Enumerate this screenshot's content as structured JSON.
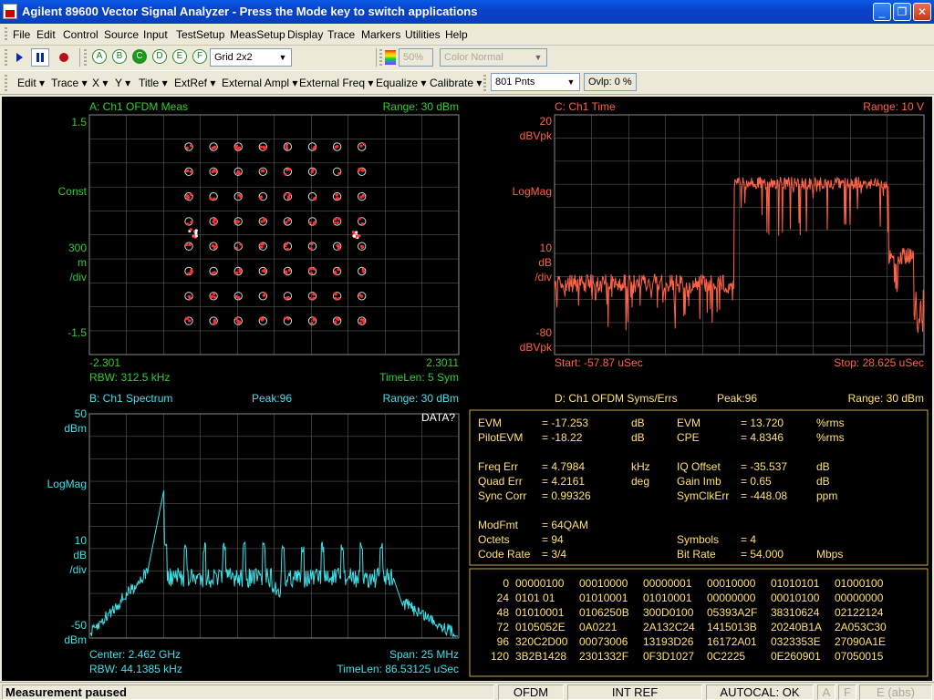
{
  "window": {
    "title": "Agilent 89600 Vector Signal Analyzer - Press the Mode key to switch applications",
    "icon_label": "VSA"
  },
  "menu": [
    "File",
    "Edit",
    "Control",
    "Source",
    "Input",
    "TestSetup",
    "MeasSetup",
    "Display",
    "Trace",
    "Markers",
    "Utilities",
    "Help"
  ],
  "toolbar1": {
    "trace_buttons": [
      "A",
      "B",
      "C",
      "D",
      "E",
      "F"
    ],
    "active_trace": "C",
    "layout": "Grid 2x2",
    "zoom": "50%",
    "color_mode": "Color Normal"
  },
  "toolbar2": {
    "menus": [
      "Edit",
      "Trace",
      "X",
      "Y",
      "Title",
      "ExtRef",
      "External Ampl",
      "External Freq",
      "Equalize",
      "Calibrate"
    ],
    "points": "801 Pnts",
    "overlap": "Ovlp: 0 %"
  },
  "colors": {
    "trace_red": "#ff6347",
    "trace_cyan": "#40e0e8",
    "label_green": "#32cd32",
    "label_red": "#ff6347",
    "label_cyan": "#40e0e8",
    "summary_yellow": "#ffe070",
    "grid": "#7a7a7a"
  },
  "panelA": {
    "title": "A: Ch1 OFDM Meas",
    "range": "Range: 30 dBm",
    "y_top": "1.5",
    "y_label": "Const",
    "y_scale_1": "300",
    "y_scale_2": "m",
    "y_scale_3": "/div",
    "y_bottom": "-1.5",
    "x_left": "-2.301",
    "x_right": "2.3011",
    "footer_left": "RBW: 312.5 kHz",
    "footer_right": "TimeLen: 5  Sym"
  },
  "panelC": {
    "title": "C: Ch1 Time",
    "range": "Range: 10  V",
    "y_top_1": "20",
    "y_top_2": "dBVpk",
    "y_label": "LogMag",
    "y_scale_1": "10",
    "y_scale_2": "dB",
    "y_scale_3": "/div",
    "y_bottom_1": "-80",
    "y_bottom_2": "dBVpk",
    "footer_left": "Start: -57.87 uSec",
    "footer_right": "Stop: 28.625 uSec"
  },
  "panelB": {
    "title": "B: Ch1 Spectrum",
    "peak": "Peak:96",
    "range": "Range: 30 dBm",
    "flag": "DATA?",
    "y_top_1": "50",
    "y_top_2": "dBm",
    "y_label": "LogMag",
    "y_scale_1": "10",
    "y_scale_2": "dB",
    "y_scale_3": "/div",
    "y_bottom_1": "-50",
    "y_bottom_2": "dBm",
    "footer_center": "Center: 2.462 GHz",
    "footer_span": "Span: 25 MHz",
    "footer_rbw": "RBW: 44.1385 kHz",
    "footer_timelen": "TimeLen: 86.53125 uSec"
  },
  "panelD": {
    "title": "D: Ch1 OFDM Syms/Errs",
    "peak": "Peak:96",
    "range": "Range: 30 dBm",
    "summary": [
      {
        "k": "EVM",
        "v": "= -17.253",
        "u": "dB",
        "k2": "EVM",
        "v2": "= 13.720",
        "u2": "%rms"
      },
      {
        "k": "PilotEVM",
        "v": "= -18.22",
        "u": "dB",
        "k2": "CPE",
        "v2": "= 4.8346",
        "u2": "%rms"
      },
      {
        "k": "Freq  Err",
        "v": "= 4.7984",
        "u": "kHz",
        "k2": "IQ  Offset",
        "v2": "= -35.537",
        "u2": "dB"
      },
      {
        "k": "Quad Err",
        "v": "= 4.2161",
        "u": "deg",
        "k2": "Gain  Imb",
        "v2": "= 0.65",
        "u2": "dB"
      },
      {
        "k": "Sync Corr",
        "v": "= 0.99326",
        "u": "",
        "k2": "SymClkErr",
        "v2": "= -448.08",
        "u2": "ppm"
      },
      {
        "k": "ModFmt",
        "v": "= 64QAM",
        "u": "",
        "k2": "",
        "v2": "",
        "u2": ""
      },
      {
        "k": "Octets",
        "v": "= 94",
        "u": "",
        "k2": "Symbols",
        "v2": "= 4",
        "u2": ""
      },
      {
        "k": "Code Rate",
        "v": "= 3/4",
        "u": "",
        "k2": "Bit   Rate",
        "v2": "= 54.000",
        "u2": "Mbps"
      }
    ],
    "hex_rows": [
      {
        "idx": "0",
        "cols": [
          "00000100",
          "00010000",
          "00000001",
          "00010000",
          "01010101",
          "01000100"
        ]
      },
      {
        "idx": "24",
        "cols": [
          "0101    01",
          "01010001",
          "01010001",
          "00000000",
          "00010100",
          "00000000"
        ]
      },
      {
        "idx": "48",
        "cols": [
          "01010001",
          "0106250B",
          "300D0100",
          "05393A2F",
          "38310624",
          "02122124"
        ]
      },
      {
        "idx": "72",
        "cols": [
          "0105052E",
          "0A0221",
          "2A132C24",
          "1415013B",
          "20240B1A",
          "2A053C30"
        ]
      },
      {
        "idx": "96",
        "cols": [
          "320C2D00",
          "00073006",
          "13193D26",
          "16172A01",
          "0323353E",
          "27090A1E"
        ]
      },
      {
        "idx": "120",
        "cols": [
          "3B2B1428",
          "2301332F",
          "0F3D1027",
          "0C2225",
          "0E260901",
          "07050015"
        ]
      }
    ]
  },
  "statusbar": {
    "message": "Measurement paused",
    "demod": "OFDM",
    "ref": "INT REF",
    "autocal": "AUTOCAL: OK",
    "ind_a": "A",
    "ind_f": "F",
    "ind_e": "E (abs)"
  }
}
